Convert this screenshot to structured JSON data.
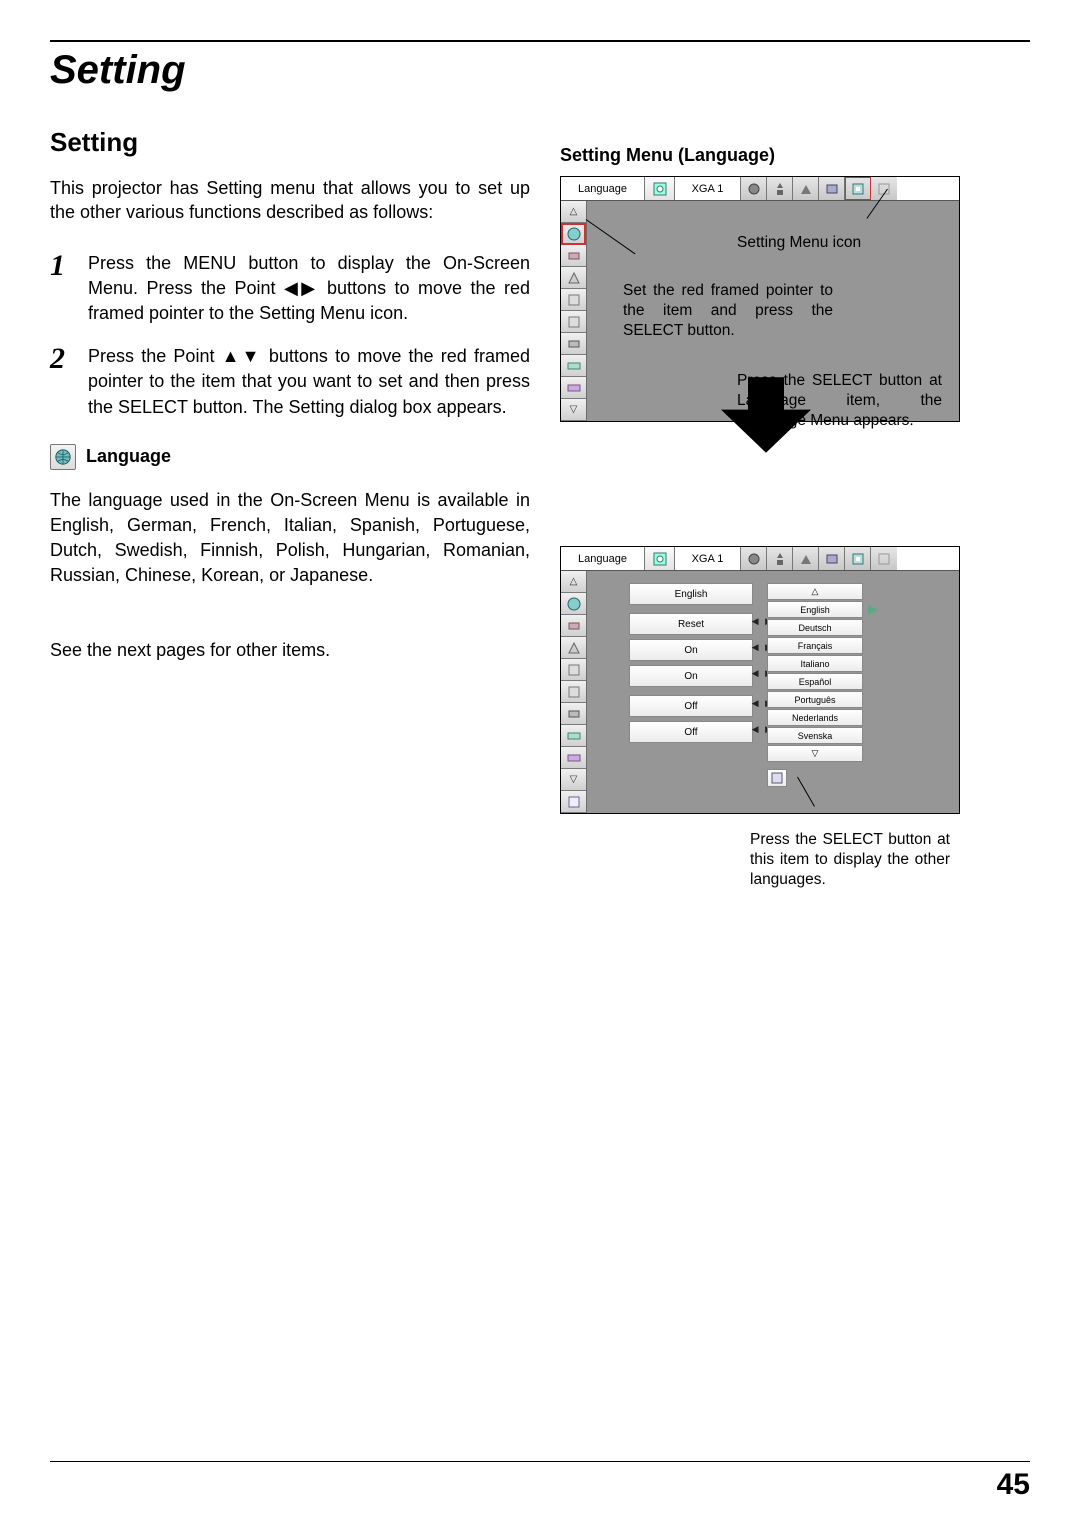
{
  "chapter": "Setting",
  "heading": "Setting",
  "intro": "This projector has Setting menu that allows you to set up the other various functions described as follows:",
  "steps": [
    "Press the MENU button to display the On-Screen Menu.  Press the Point ◀▶ buttons to move the red framed pointer to the Setting Menu icon.",
    "Press the Point ▲▼ buttons to move the red framed pointer to the item that you want to set and then press the SELECT button. The Setting dialog box appears."
  ],
  "language_heading": "Language",
  "language_para": "The language used in the On-Screen Menu is available in English, German, French, Italian, Spanish, Portuguese, Dutch, Swedish, Finnish, Polish, Hungarian, Romanian, Russian, Chinese, Korean, or Japanese.",
  "see_next": "See the next pages for other items.",
  "right_title": "Setting Menu (Language)",
  "osd": {
    "top_label": "Language",
    "source": "XGA 1"
  },
  "ann": {
    "setting_icon": "Setting Menu icon",
    "set_pointer": "Set the red framed pointer to the item and press the SELECT button.",
    "press_lang": "Press the SELECT button at Language item, the Language Menu appears.",
    "press_other": "Press the SELECT button at this item to display the other languages."
  },
  "panel2": {
    "rows": [
      "English",
      "",
      "Reset",
      "On",
      "On",
      "",
      "Off",
      "Off"
    ],
    "langs": [
      "English",
      "Deutsch",
      "Français",
      "Italiano",
      "Español",
      "Português",
      "Nederlands",
      "Svenska"
    ]
  },
  "page_number": "45"
}
